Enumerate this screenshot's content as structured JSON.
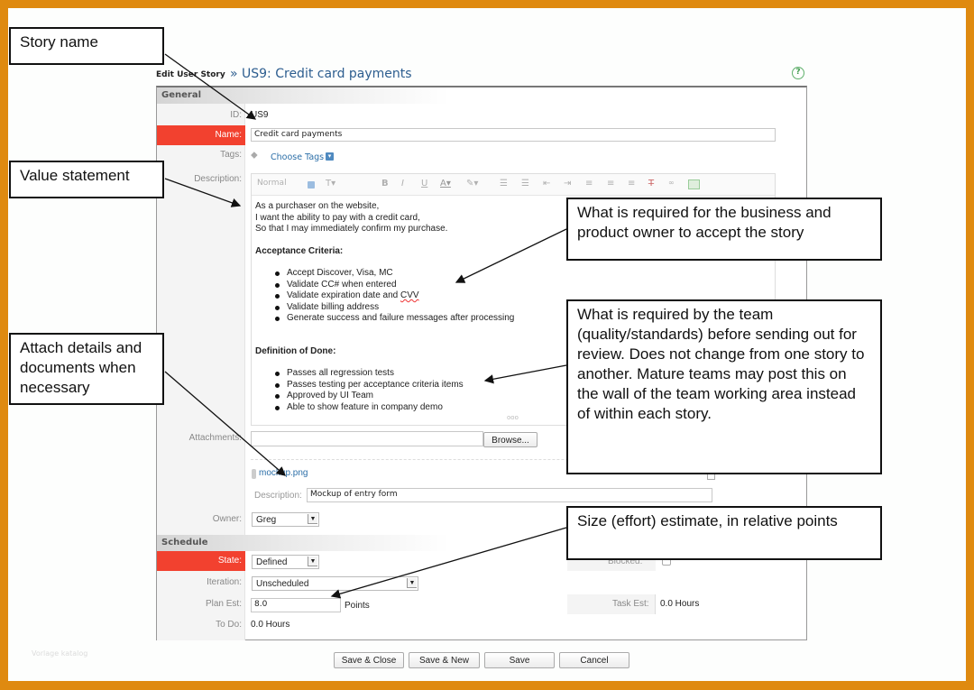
{
  "header": {
    "breadcrumb_label": "Edit User Story",
    "title": "» US9: Credit card payments",
    "help_icon": "help-icon"
  },
  "general": {
    "section_title": "General",
    "id_label": "ID:",
    "id_value": "US9",
    "name_label": "Name:",
    "name_value": "Credit card payments",
    "tags_label": "Tags:",
    "tags_link": "Choose Tags",
    "description_label": "Description:",
    "editor": {
      "format_select": "Normal",
      "toolbar_icons": [
        "font-size-icon",
        "bold-icon",
        "italic-icon",
        "underline-icon",
        "text-color-icon",
        "highlight-icon",
        "numbered-list-icon",
        "bullet-list-icon",
        "outdent-icon",
        "indent-icon",
        "align-left-icon",
        "align-center-icon",
        "align-right-icon",
        "clear-format-icon",
        "link-icon",
        "image-icon"
      ],
      "value_statement": [
        "As a purchaser on the website,",
        "I want the ability to pay with a credit card,",
        "So that I may immediately confirm my purchase."
      ],
      "acceptance_heading": "Acceptance Criteria:",
      "acceptance_items": [
        "Accept Discover, Visa, MC",
        "Validate CC# when entered",
        "Validate expiration date and ",
        "Validate billing address",
        "Generate success and failure messages after processing"
      ],
      "acceptance_item_2_tail": "CVV",
      "dod_heading": "Definition of Done:",
      "dod_items": [
        "Passes all regression tests",
        "Passes testing per acceptance criteria items",
        "Approved by UI Team",
        "Able to show feature in company demo"
      ]
    },
    "attachments_label": "Attachments:",
    "browse_button": "Browse...",
    "attachment_file": "mockup.png",
    "attachment_desc_label": "Description:",
    "attachment_desc_value": "Mockup of entry form",
    "owner_label": "Owner:",
    "owner_value": "Greg"
  },
  "schedule": {
    "section_title": "Schedule",
    "state_label": "State:",
    "state_value": "Defined",
    "iteration_label": "Iteration:",
    "iteration_value": "Unscheduled",
    "plan_est_label": "Plan Est:",
    "plan_est_value": "8.0",
    "plan_est_unit": "Points",
    "todo_label": "To Do:",
    "todo_value": "0.0 Hours",
    "blocked_label": "Blocked:",
    "task_est_label": "Task Est:",
    "task_est_value": "0.0 Hours"
  },
  "footer": {
    "save_close": "Save & Close",
    "save_new": "Save & New",
    "save": "Save",
    "cancel": "Cancel"
  },
  "callouts": {
    "story_name": "Story name",
    "value_statement": "Value statement",
    "acceptance": "What is required for the business and product owner to accept the story",
    "dod": "What is required by the team (quality/standards) before sending out for review. Does not change from one story to another. Mature teams may post this on the wall of the team working area instead of within each story.",
    "attach": "Attach details and documents when necessary",
    "estimate": "Size (effort) estimate, in relative points"
  },
  "watermark": "Vorlage katalog",
  "colors": {
    "frame": "#df8a10",
    "required": "#f2412f",
    "link": "#2c6fa8",
    "title": "#2c5d8f"
  }
}
